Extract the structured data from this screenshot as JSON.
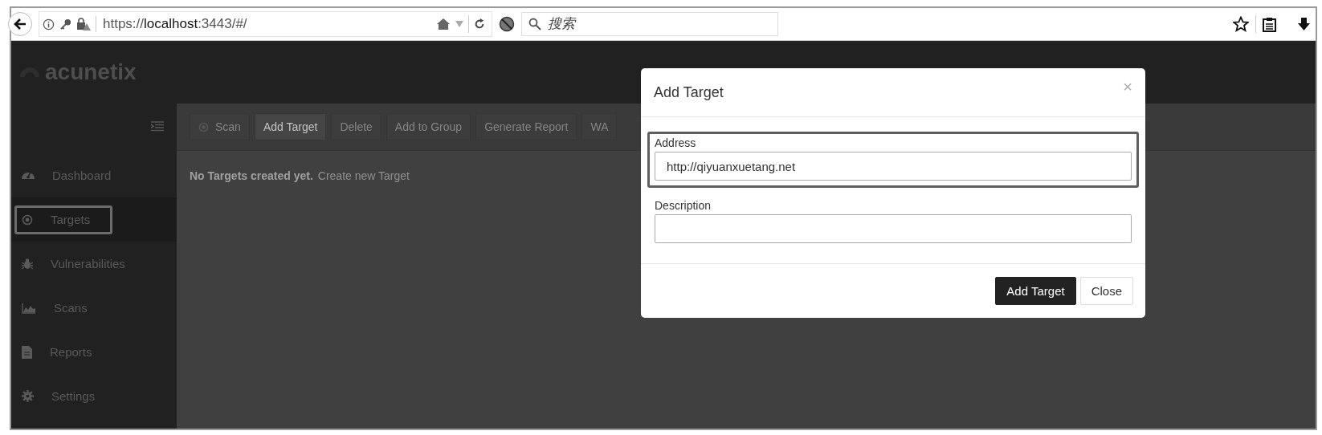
{
  "browser": {
    "url": "https://**localhost**:3443/#/",
    "search": {
      "placeholder": "搜索"
    }
  },
  "app": {
    "logo": "acunetix"
  },
  "sidebar": {
    "items": [
      {
        "label": "Dashboard",
        "selected": false
      },
      {
        "label": "Targets",
        "selected": true
      },
      {
        "label": "Vulnerabilities",
        "selected": false
      },
      {
        "label": "Scans",
        "selected": false
      },
      {
        "label": "Reports",
        "selected": false
      },
      {
        "label": "Settings",
        "selected": false
      }
    ]
  },
  "toolbar": {
    "buttons": [
      {
        "label": "Scan",
        "disabled": true
      },
      {
        "label": "Add Target",
        "disabled": false
      },
      {
        "label": "Delete",
        "disabled": true
      },
      {
        "label": "Add to Group",
        "disabled": true
      },
      {
        "label": "Generate Report",
        "disabled": true
      },
      {
        "label": "WA",
        "disabled": true
      }
    ]
  },
  "content": {
    "empty_message": "No Targets created yet.",
    "link": "Create new Target"
  },
  "modal": {
    "title": "Add Target",
    "close": "×",
    "fields": [
      {
        "label": "Address",
        "value": "http://qiyuanxuetang.net",
        "highlighted": true
      },
      {
        "label": "Description",
        "highlighted": false
      }
    ],
    "buttons": [
      {
        "label": "Add Target",
        "kind": "primary"
      },
      {
        "label": "Close",
        "kind": "default"
      }
    ]
  }
}
